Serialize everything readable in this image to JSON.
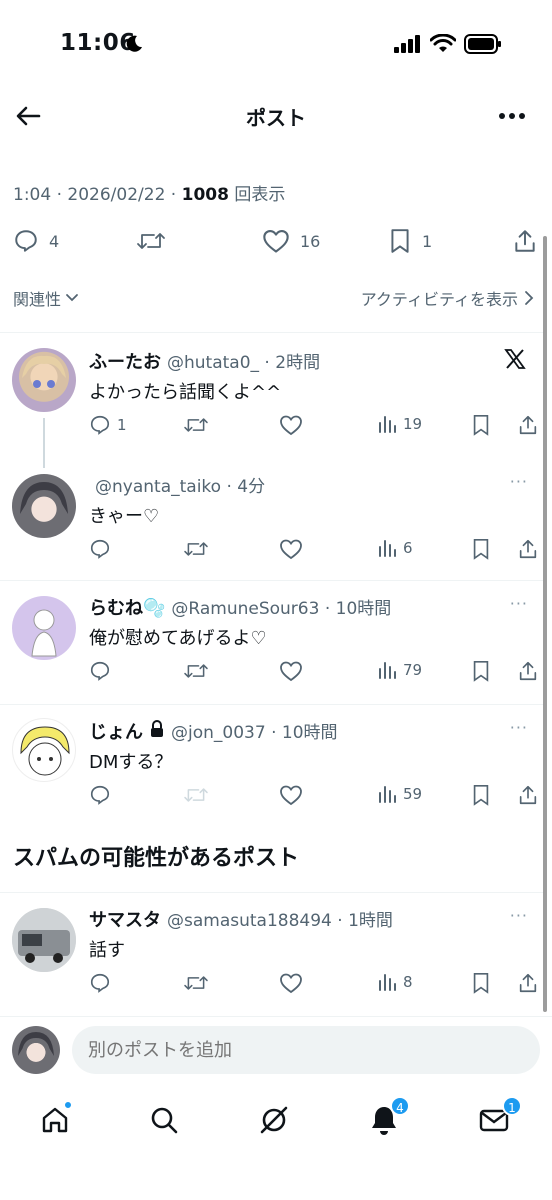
{
  "status_bar": {
    "time": "11:06"
  },
  "header": {
    "title": "ポスト"
  },
  "post_meta": {
    "time": "1:04",
    "date": "2026/02/22",
    "views": "1008",
    "views_suffix": "回表示"
  },
  "post_actions": {
    "replies": "4",
    "likes": "16",
    "bookmarks": "1"
  },
  "sort": {
    "left_label": "関連性",
    "right_label": "アクティビティを表示"
  },
  "replies": [
    {
      "name": "ふーたお",
      "handle": "@hutata0_",
      "time": "2時間",
      "text": "よかったら話聞くよ^^",
      "replies": "1",
      "views": "19"
    },
    {
      "name": "",
      "handle": "@nyanta_taiko",
      "time": "4分",
      "text": "きゃー♡",
      "replies": "",
      "views": "6"
    },
    {
      "name": "らむね🫧",
      "handle": "@RamuneSour63",
      "time": "10時間",
      "text": "俺が慰めてあげるよ♡",
      "replies": "",
      "views": "79"
    },
    {
      "name": "じょん",
      "handle": "@jon_0037",
      "time": "10時間",
      "text": "DMする？",
      "replies": "",
      "views": "59"
    }
  ],
  "spam_section": {
    "title": "スパムの可能性があるポスト"
  },
  "spam_replies": [
    {
      "name": "サマスタ",
      "handle": "@samasuta188494",
      "time": "1時間",
      "text": "話す",
      "replies": "",
      "views": "8"
    }
  ],
  "composer": {
    "placeholder": "別のポストを追加"
  },
  "tab_bar": {
    "notifications_badge": "4",
    "messages_badge": "1"
  },
  "colors": {
    "accent": "#1d9bf0",
    "text": "#0f1419",
    "muted": "#536471"
  }
}
